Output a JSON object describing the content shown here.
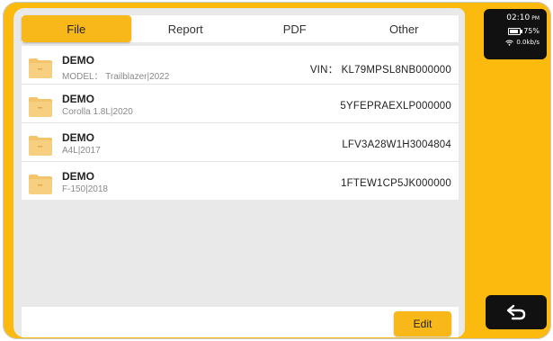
{
  "tabs": [
    {
      "label": "File",
      "active": true
    },
    {
      "label": "Report",
      "active": false
    },
    {
      "label": "PDF",
      "active": false
    },
    {
      "label": "Other",
      "active": false
    }
  ],
  "files": [
    {
      "title": "DEMO",
      "subtitle": "MODEL： Trailblazer|2022",
      "vin": "VIN： KL79MPSL8NB000000"
    },
    {
      "title": "DEMO",
      "subtitle": "Corolla 1.8L|2020",
      "vin": "5YFEPRAEXLP000000"
    },
    {
      "title": "DEMO",
      "subtitle": "A4L|2017",
      "vin": "LFV3A28W1H3004804"
    },
    {
      "title": "DEMO",
      "subtitle": "F-150|2018",
      "vin": "1FTEW1CP5JK000000"
    }
  ],
  "edit_label": "Edit",
  "status": {
    "time": "02:10",
    "meridiem": "PM",
    "battery": "75%",
    "battery_level": 0.75,
    "network": "0.0kb/s"
  },
  "icons": {
    "folder": "folder-icon",
    "battery": "battery-icon",
    "wifi": "wifi-icon",
    "back": "back-arrow-icon"
  },
  "colors": {
    "accent": "#F8B81A",
    "frame": "#FDBA0E",
    "panel": "#111111",
    "background": "#E9E9E9"
  }
}
